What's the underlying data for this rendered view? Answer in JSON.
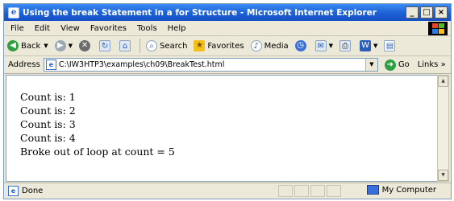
{
  "window": {
    "title": "Using the break Statement in a for Structure - Microsoft Internet Explorer",
    "controls": {
      "minimize": "_",
      "maximize": "□",
      "close": "×"
    }
  },
  "menu": [
    "File",
    "Edit",
    "View",
    "Favorites",
    "Tools",
    "Help"
  ],
  "toolbar": {
    "back": "Back",
    "search": "Search",
    "favorites": "Favorites",
    "media": "Media"
  },
  "address": {
    "label": "Address",
    "url": "C:\\IW3HTP3\\examples\\ch09\\BreakTest.html",
    "go": "Go",
    "links": "Links »"
  },
  "content": {
    "lines": [
      "Count is: 1",
      "Count is: 2",
      "Count is: 3",
      "Count is: 4",
      "Broke out of loop at count = 5"
    ]
  },
  "status": {
    "text": "Done",
    "zone": "My Computer"
  },
  "colors": {
    "titlebar": "#1c5fd6",
    "chrome": "#ece9d8"
  },
  "icons": [
    "ie-page-icon",
    "back-arrow-icon",
    "forward-arrow-icon",
    "stop-icon",
    "refresh-icon",
    "home-icon",
    "search-icon",
    "favorites-icon",
    "media-icon",
    "history-icon",
    "mail-icon",
    "print-icon",
    "edit-icon",
    "discuss-icon",
    "go-icon",
    "my-computer-icon"
  ]
}
